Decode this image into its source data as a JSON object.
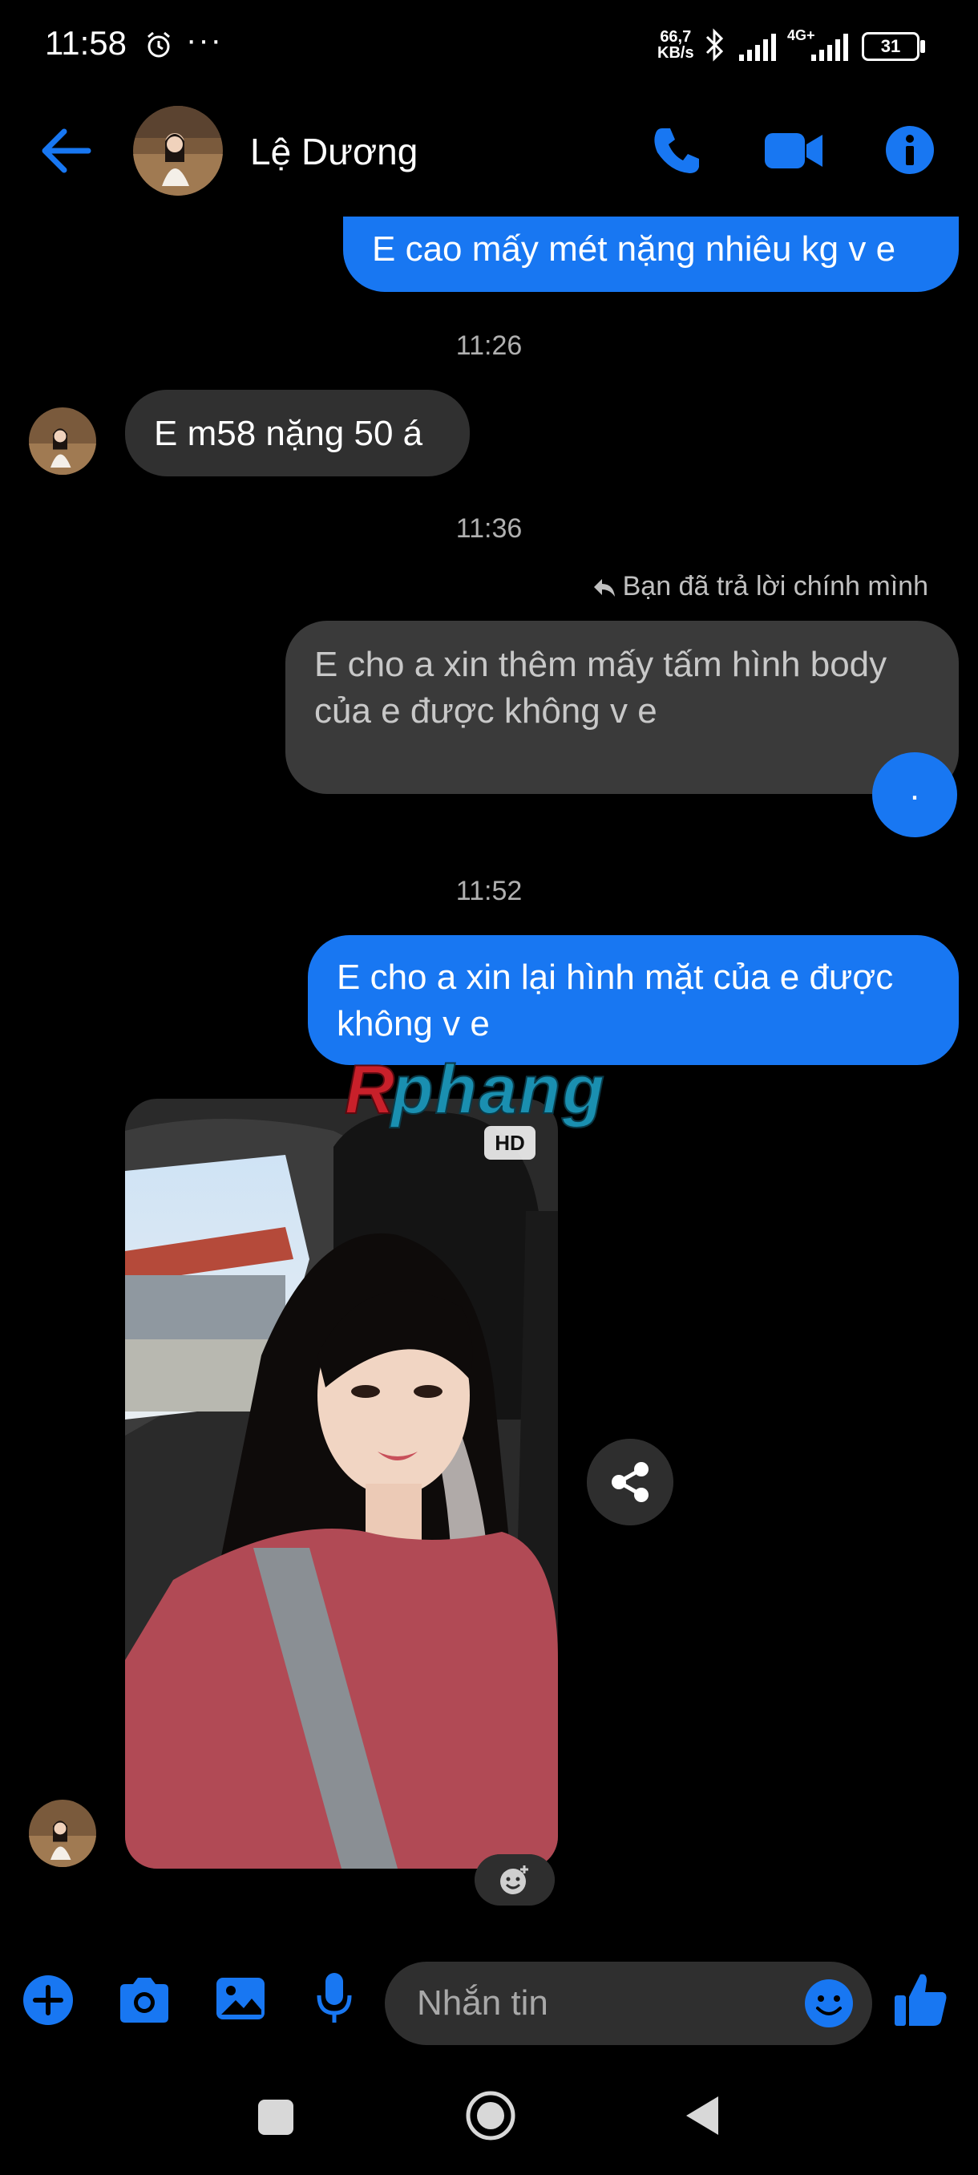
{
  "status_bar": {
    "time": "11:58",
    "dots": "···",
    "net_speed_value": "66,7",
    "net_speed_unit": "KB/s",
    "network": "4G+",
    "battery": "31"
  },
  "header": {
    "contact_name": "Lệ Dương"
  },
  "messages": [
    {
      "direction": "outgoing",
      "text": "E cao mấy mét nặng nhiêu kg v e"
    },
    {
      "type": "timestamp",
      "text": "11:26"
    },
    {
      "direction": "incoming",
      "text": "E m58 nặng 50 á"
    },
    {
      "type": "timestamp",
      "text": "11:36"
    },
    {
      "type": "reply_note",
      "text": "Bạn đã trả lời chính mình"
    },
    {
      "direction": "outgoing",
      "text": "E cho a xin thêm mấy tấm hình body của e được không v e"
    },
    {
      "type": "seen_marker",
      "text": "."
    },
    {
      "type": "timestamp",
      "text": "11:52"
    },
    {
      "direction": "outgoing",
      "text": "E cho a xin lại hình mặt của e được không v e"
    },
    {
      "direction": "incoming",
      "type": "photo",
      "badge": "HD"
    }
  ],
  "watermark": "Rphang",
  "composer": {
    "placeholder": "Nhắn tin"
  },
  "colors": {
    "accent": "#1877f2",
    "background": "#000000",
    "incoming_bubble": "#303030"
  },
  "icons": [
    "back-arrow-icon",
    "phone-icon",
    "video-icon",
    "info-icon",
    "share-icon",
    "add-reaction-icon",
    "plus-icon",
    "camera-icon",
    "gallery-icon",
    "mic-icon",
    "emoji-icon",
    "like-icon"
  ]
}
